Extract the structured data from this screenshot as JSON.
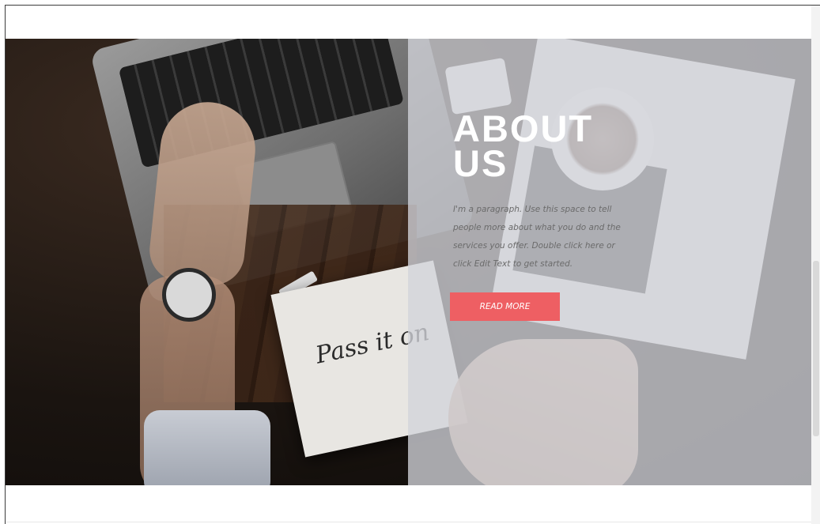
{
  "about": {
    "title": "ABOUT US",
    "paragraph": "I'm a paragraph. Use this space to tell people more about what you do and the services you offer. Double click here or click Edit Text to get started.",
    "button_label": "READ MORE"
  },
  "decor": {
    "notebook_text": "Pass it on"
  },
  "colors": {
    "accent": "#ee5f63",
    "overlay": "#d2d4da",
    "title_text": "#ffffff",
    "paragraph_text": "#6b6b6b"
  }
}
